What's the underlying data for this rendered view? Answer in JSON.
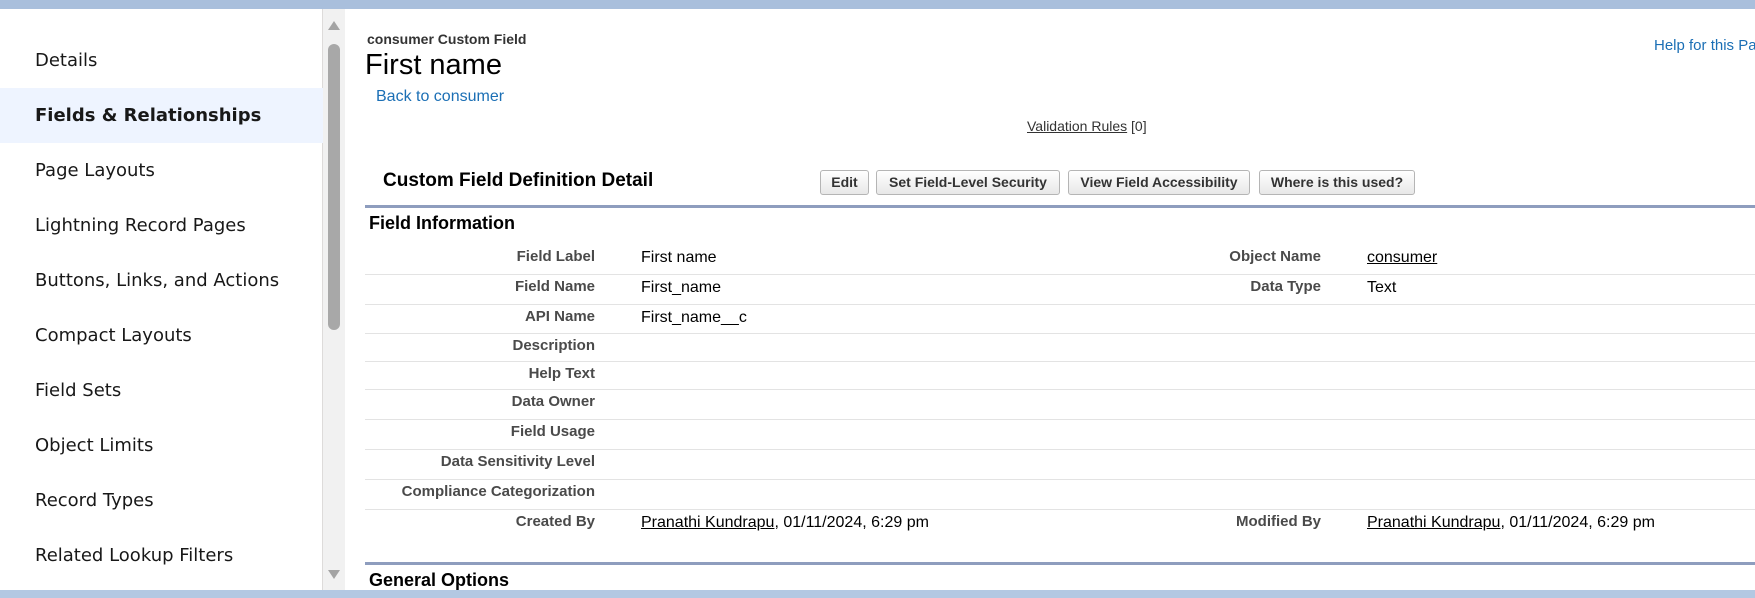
{
  "sidebar": {
    "items": [
      {
        "label": "Details"
      },
      {
        "label": "Fields & Relationships"
      },
      {
        "label": "Page Layouts"
      },
      {
        "label": "Lightning Record Pages"
      },
      {
        "label": "Buttons, Links, and Actions"
      },
      {
        "label": "Compact Layouts"
      },
      {
        "label": "Field Sets"
      },
      {
        "label": "Object Limits"
      },
      {
        "label": "Record Types"
      },
      {
        "label": "Related Lookup Filters"
      }
    ],
    "active_index": 1
  },
  "header": {
    "breadcrumb": "consumer Custom Field",
    "title": "First name",
    "back_link": "Back to consumer",
    "help_link": "Help for this Pa"
  },
  "validation": {
    "link": "Validation Rules",
    "count": "[0]"
  },
  "detail": {
    "section_title": "Custom Field Definition Detail",
    "buttons": {
      "edit": "Edit",
      "set_fls": "Set Field-Level Security",
      "view_access": "View Field Accessibility",
      "where_used": "Where is this used?"
    },
    "field_info_heading": "Field Information",
    "labels": {
      "field_label": "Field Label",
      "field_name": "Field Name",
      "api_name": "API Name",
      "description": "Description",
      "help_text": "Help Text",
      "data_owner": "Data Owner",
      "field_usage": "Field Usage",
      "sensitivity": "Data Sensitivity Level",
      "compliance": "Compliance Categorization",
      "created_by": "Created By",
      "object_name": "Object Name",
      "data_type": "Data Type",
      "modified_by": "Modified By"
    },
    "values": {
      "field_label": "First name",
      "field_name": "First_name",
      "api_name": "First_name__c",
      "object_name": "consumer",
      "data_type": "Text",
      "created_by_user": "Pranathi Kundrapu",
      "created_by_date": ", 01/11/2024, 6:29 pm",
      "modified_by_user": "Pranathi Kundrapu",
      "modified_by_date": ", 01/11/2024, 6:29 pm"
    },
    "general_options_heading": "General Options"
  }
}
